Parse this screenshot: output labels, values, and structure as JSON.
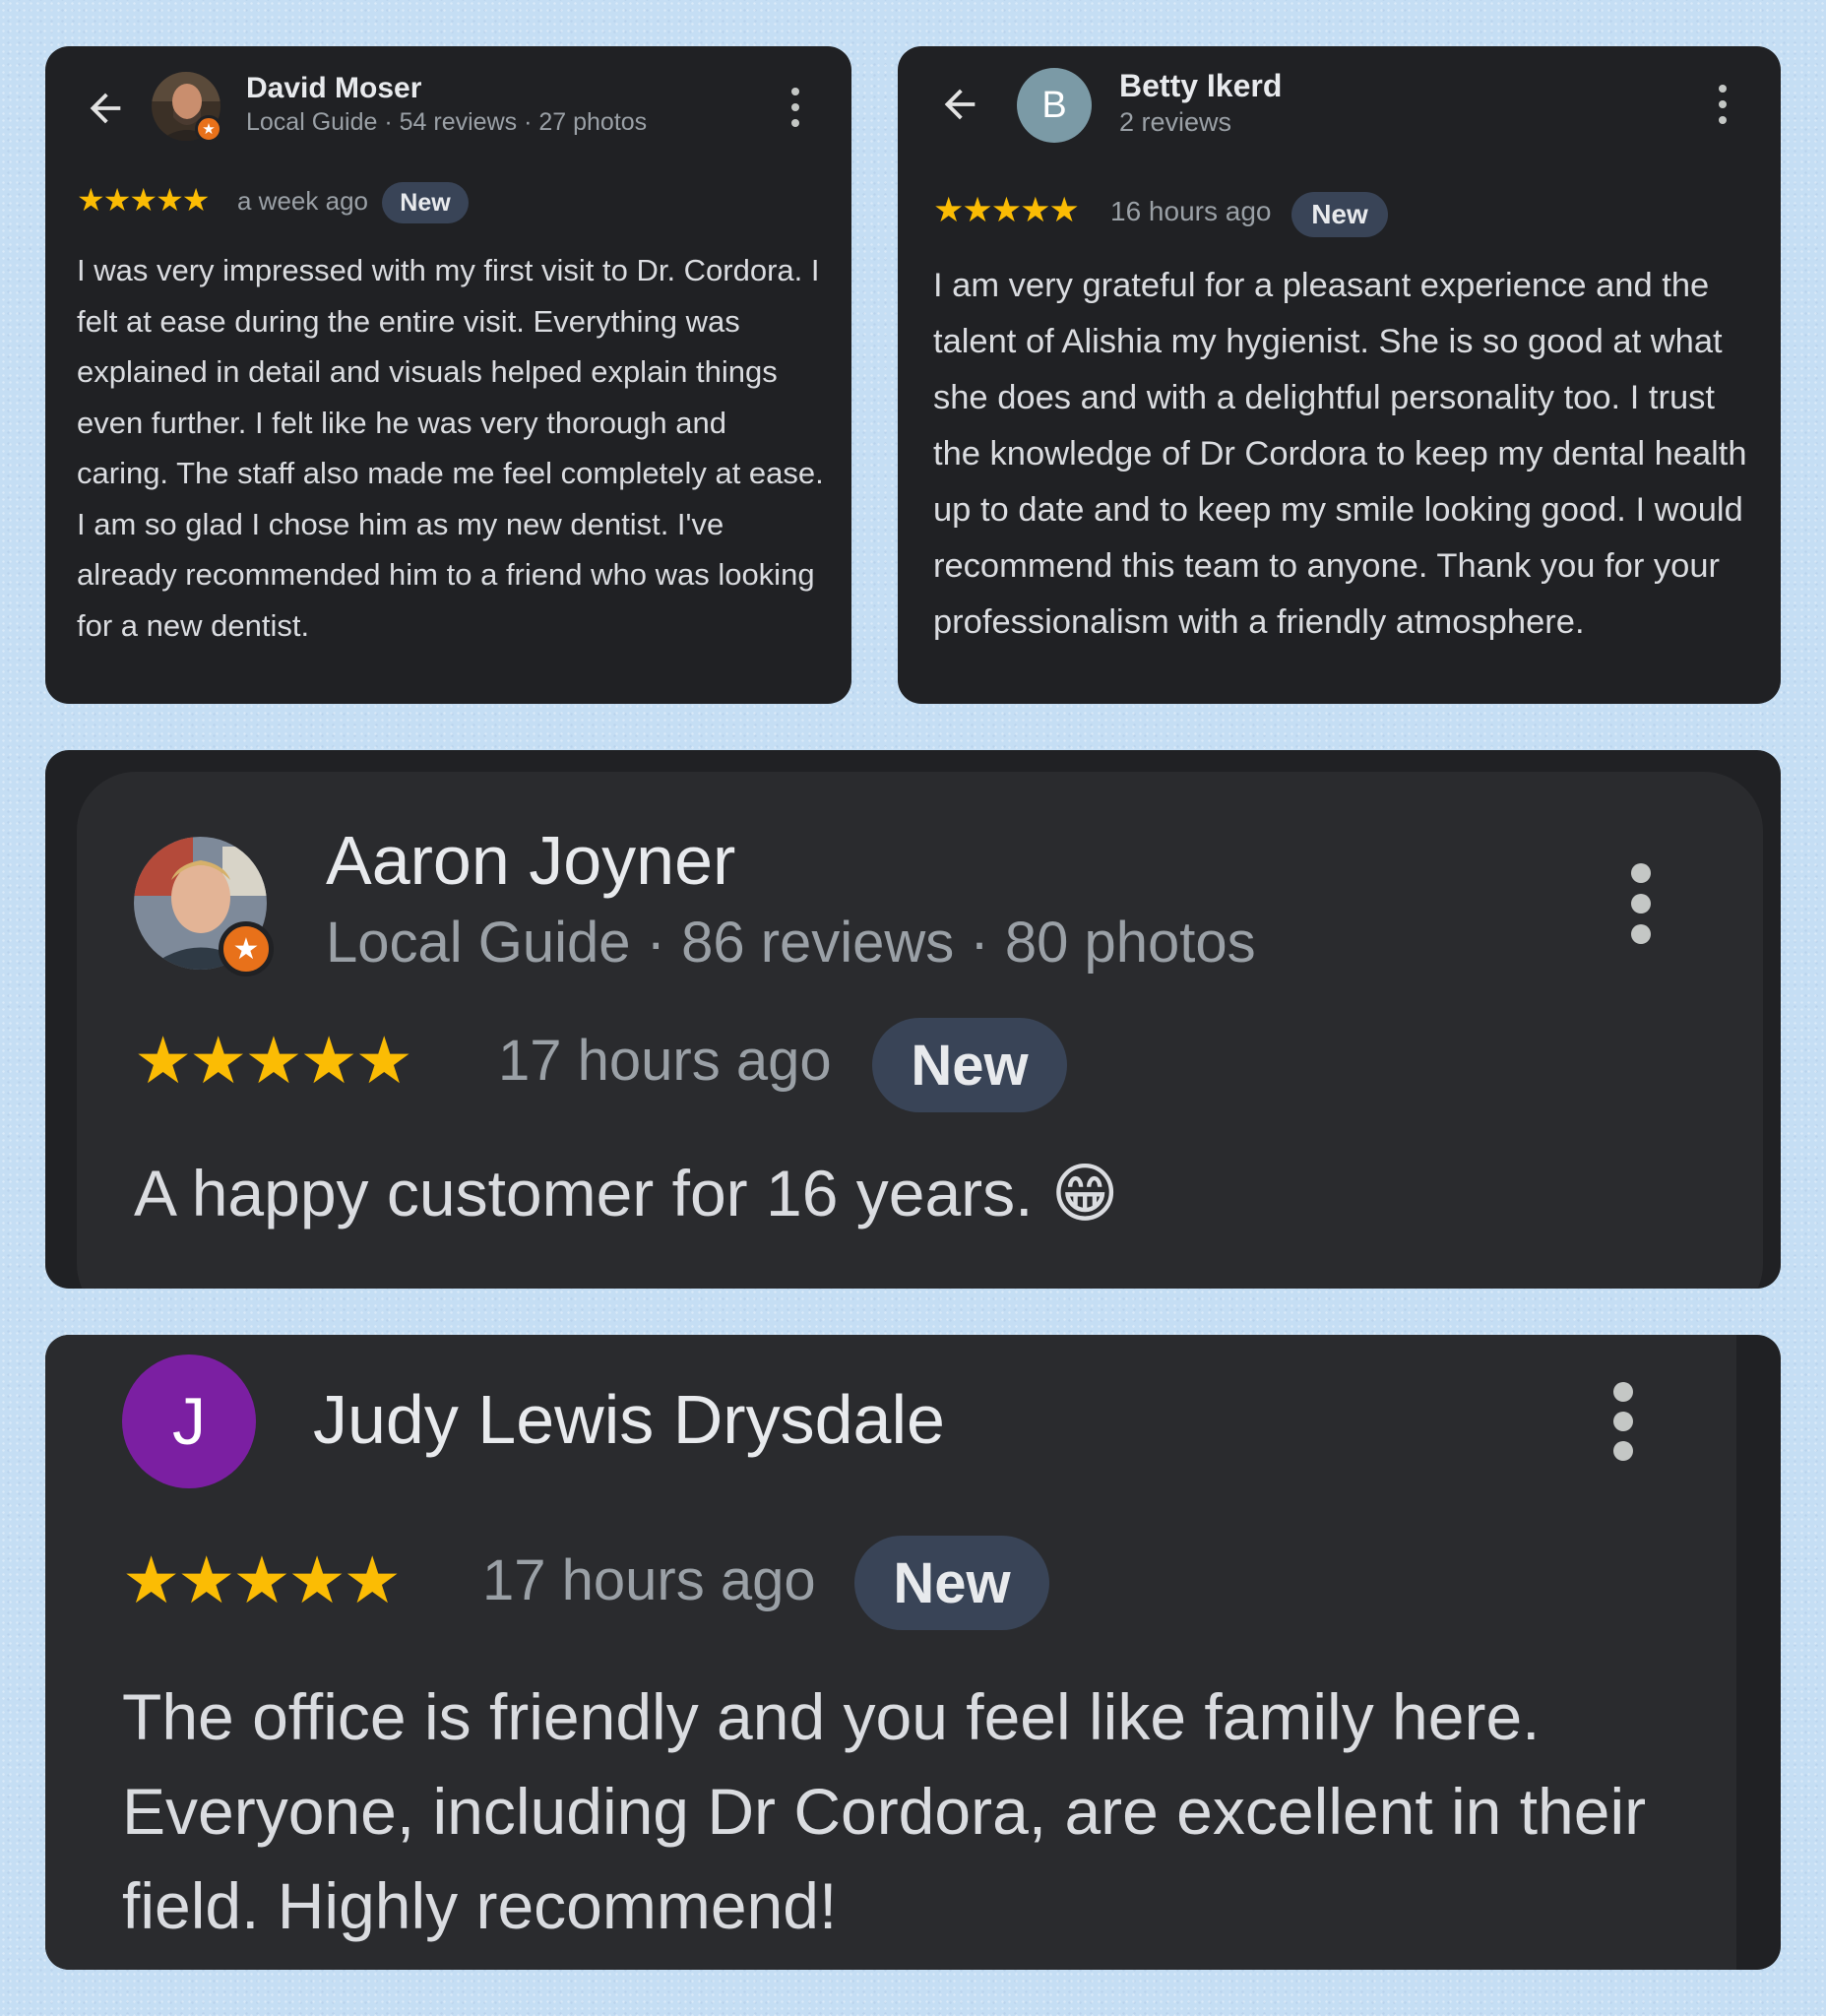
{
  "reviews": [
    {
      "name": "David Moser",
      "meta": "Local Guide · 54 reviews · 27 photos",
      "stars": "★★★★★",
      "time": "a week ago",
      "badge": "New",
      "text": "I was very impressed with my first visit to Dr. Cordora. I felt at ease during the entire visit. Everything was explained in detail and visuals helped explain things even further. I felt like he was very thorough and caring. The staff also made me feel completely at ease. I am so glad I chose him as my new dentist. I've already recommended him to a friend who was looking for a new dentist."
    },
    {
      "name": "Betty Ikerd",
      "avatar_letter": "B",
      "meta": "2 reviews",
      "stars": "★★★★★",
      "time": "16 hours ago",
      "badge": "New",
      "text": "I am very grateful for a pleasant experience and the talent of Alishia my hygienist. She is so good at what she does and with a delightful personality too. I trust the knowledge of Dr Cordora to keep my dental health up to date and to keep my smile looking good. I would recommend this team to anyone. Thank you for your professionalism with a friendly atmosphere."
    },
    {
      "name": "Aaron Joyner",
      "meta": "Local Guide · 86 reviews · 80 photos",
      "stars": "★★★★★",
      "time": "17 hours ago",
      "badge": "New",
      "text": "A happy customer for 16 years. 😁"
    },
    {
      "name": "Judy Lewis Drysdale",
      "avatar_letter": "J",
      "stars": "★★★★★",
      "time": "17 hours ago",
      "badge": "New",
      "text": "The office is friendly and you feel like family here. Everyone, including Dr Cordora, are excellent in their field. Highly recommend!"
    }
  ],
  "colors": {
    "background": "#c5def4",
    "card": "#202124",
    "star": "#fbbc04",
    "pill": "#394457",
    "avatar_b": "#7b9aa6",
    "avatar_j": "#7b1fa2",
    "local_guide_badge": "#e8711a"
  },
  "icons": {
    "back": "arrow-back-icon",
    "more": "more-vertical-icon",
    "local_guide": "star-badge-icon"
  }
}
